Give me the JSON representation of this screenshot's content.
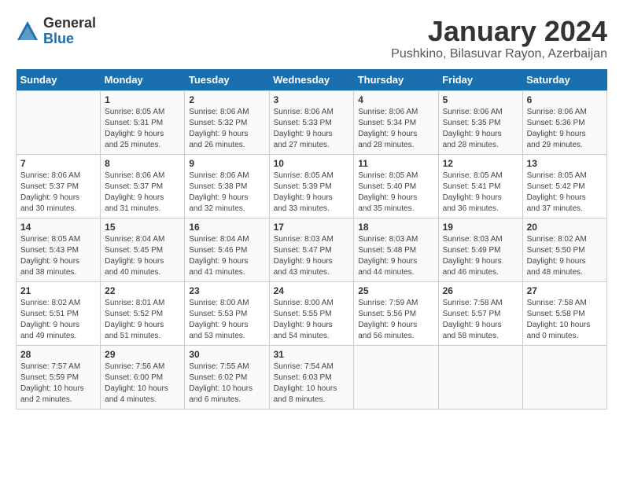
{
  "logo": {
    "general": "General",
    "blue": "Blue"
  },
  "title": "January 2024",
  "location": "Pushkino, Bilasuvar Rayon, Azerbaijan",
  "days_of_week": [
    "Sunday",
    "Monday",
    "Tuesday",
    "Wednesday",
    "Thursday",
    "Friday",
    "Saturday"
  ],
  "weeks": [
    [
      {
        "day": "",
        "details": ""
      },
      {
        "day": "1",
        "details": "Sunrise: 8:05 AM\nSunset: 5:31 PM\nDaylight: 9 hours\nand 25 minutes."
      },
      {
        "day": "2",
        "details": "Sunrise: 8:06 AM\nSunset: 5:32 PM\nDaylight: 9 hours\nand 26 minutes."
      },
      {
        "day": "3",
        "details": "Sunrise: 8:06 AM\nSunset: 5:33 PM\nDaylight: 9 hours\nand 27 minutes."
      },
      {
        "day": "4",
        "details": "Sunrise: 8:06 AM\nSunset: 5:34 PM\nDaylight: 9 hours\nand 28 minutes."
      },
      {
        "day": "5",
        "details": "Sunrise: 8:06 AM\nSunset: 5:35 PM\nDaylight: 9 hours\nand 28 minutes."
      },
      {
        "day": "6",
        "details": "Sunrise: 8:06 AM\nSunset: 5:36 PM\nDaylight: 9 hours\nand 29 minutes."
      }
    ],
    [
      {
        "day": "7",
        "details": "Sunrise: 8:06 AM\nSunset: 5:37 PM\nDaylight: 9 hours\nand 30 minutes."
      },
      {
        "day": "8",
        "details": "Sunrise: 8:06 AM\nSunset: 5:37 PM\nDaylight: 9 hours\nand 31 minutes."
      },
      {
        "day": "9",
        "details": "Sunrise: 8:06 AM\nSunset: 5:38 PM\nDaylight: 9 hours\nand 32 minutes."
      },
      {
        "day": "10",
        "details": "Sunrise: 8:05 AM\nSunset: 5:39 PM\nDaylight: 9 hours\nand 33 minutes."
      },
      {
        "day": "11",
        "details": "Sunrise: 8:05 AM\nSunset: 5:40 PM\nDaylight: 9 hours\nand 35 minutes."
      },
      {
        "day": "12",
        "details": "Sunrise: 8:05 AM\nSunset: 5:41 PM\nDaylight: 9 hours\nand 36 minutes."
      },
      {
        "day": "13",
        "details": "Sunrise: 8:05 AM\nSunset: 5:42 PM\nDaylight: 9 hours\nand 37 minutes."
      }
    ],
    [
      {
        "day": "14",
        "details": "Sunrise: 8:05 AM\nSunset: 5:43 PM\nDaylight: 9 hours\nand 38 minutes."
      },
      {
        "day": "15",
        "details": "Sunrise: 8:04 AM\nSunset: 5:45 PM\nDaylight: 9 hours\nand 40 minutes."
      },
      {
        "day": "16",
        "details": "Sunrise: 8:04 AM\nSunset: 5:46 PM\nDaylight: 9 hours\nand 41 minutes."
      },
      {
        "day": "17",
        "details": "Sunrise: 8:03 AM\nSunset: 5:47 PM\nDaylight: 9 hours\nand 43 minutes."
      },
      {
        "day": "18",
        "details": "Sunrise: 8:03 AM\nSunset: 5:48 PM\nDaylight: 9 hours\nand 44 minutes."
      },
      {
        "day": "19",
        "details": "Sunrise: 8:03 AM\nSunset: 5:49 PM\nDaylight: 9 hours\nand 46 minutes."
      },
      {
        "day": "20",
        "details": "Sunrise: 8:02 AM\nSunset: 5:50 PM\nDaylight: 9 hours\nand 48 minutes."
      }
    ],
    [
      {
        "day": "21",
        "details": "Sunrise: 8:02 AM\nSunset: 5:51 PM\nDaylight: 9 hours\nand 49 minutes."
      },
      {
        "day": "22",
        "details": "Sunrise: 8:01 AM\nSunset: 5:52 PM\nDaylight: 9 hours\nand 51 minutes."
      },
      {
        "day": "23",
        "details": "Sunrise: 8:00 AM\nSunset: 5:53 PM\nDaylight: 9 hours\nand 53 minutes."
      },
      {
        "day": "24",
        "details": "Sunrise: 8:00 AM\nSunset: 5:55 PM\nDaylight: 9 hours\nand 54 minutes."
      },
      {
        "day": "25",
        "details": "Sunrise: 7:59 AM\nSunset: 5:56 PM\nDaylight: 9 hours\nand 56 minutes."
      },
      {
        "day": "26",
        "details": "Sunrise: 7:58 AM\nSunset: 5:57 PM\nDaylight: 9 hours\nand 58 minutes."
      },
      {
        "day": "27",
        "details": "Sunrise: 7:58 AM\nSunset: 5:58 PM\nDaylight: 10 hours\nand 0 minutes."
      }
    ],
    [
      {
        "day": "28",
        "details": "Sunrise: 7:57 AM\nSunset: 5:59 PM\nDaylight: 10 hours\nand 2 minutes."
      },
      {
        "day": "29",
        "details": "Sunrise: 7:56 AM\nSunset: 6:00 PM\nDaylight: 10 hours\nand 4 minutes."
      },
      {
        "day": "30",
        "details": "Sunrise: 7:55 AM\nSunset: 6:02 PM\nDaylight: 10 hours\nand 6 minutes."
      },
      {
        "day": "31",
        "details": "Sunrise: 7:54 AM\nSunset: 6:03 PM\nDaylight: 10 hours\nand 8 minutes."
      },
      {
        "day": "",
        "details": ""
      },
      {
        "day": "",
        "details": ""
      },
      {
        "day": "",
        "details": ""
      }
    ]
  ]
}
